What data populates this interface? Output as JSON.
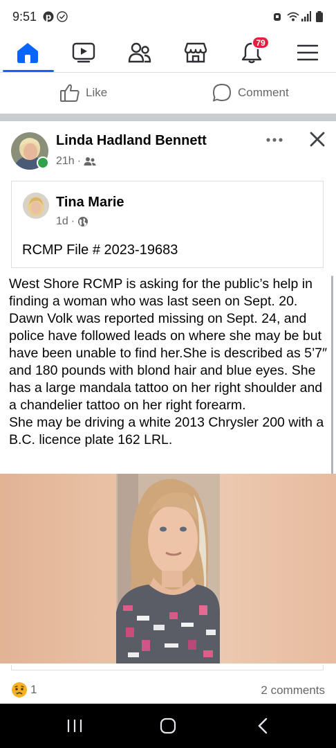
{
  "status_bar": {
    "time": "9:51"
  },
  "tabs": [
    {
      "name": "home",
      "icon": "home-icon",
      "active": true
    },
    {
      "name": "watch",
      "icon": "video-icon"
    },
    {
      "name": "friends",
      "icon": "friends-icon"
    },
    {
      "name": "marketplace",
      "icon": "marketplace-icon"
    },
    {
      "name": "notifications",
      "icon": "bell-icon",
      "badge": "79"
    },
    {
      "name": "menu",
      "icon": "hamburger-icon"
    }
  ],
  "actions": {
    "like_label": "Like",
    "comment_label": "Comment"
  },
  "post": {
    "author": "Linda Hadland Bennett",
    "time": "21h",
    "audience_icon": "friends-icon",
    "shared": {
      "author": "Tina Marie",
      "time": "1d",
      "audience_icon": "globe-icon",
      "text": "RCMP File # 2023-19683"
    },
    "body": "West Shore RCMP is asking for the public’s help in finding a woman who was last seen on Sept. 20. Dawn Volk was reported missing on Sept. 24, and police have followed leads on where she may be but have been unable to find her.She is described as 5’7″ and 180 pounds with blond hair and blue eyes. She has a large mandala tattoo on her right shoulder and a chandelier tattoo on her right forearm.\nShe may be driving a white 2013 Chrysler 200 with a B.C. licence plate 162 LRL.",
    "reaction_icon": "sad-reaction-icon",
    "reaction_count": "1",
    "comments": "2 comments"
  },
  "colors": {
    "accent": "#0866ff",
    "badge": "#e41e3f",
    "online": "#31a24c"
  }
}
